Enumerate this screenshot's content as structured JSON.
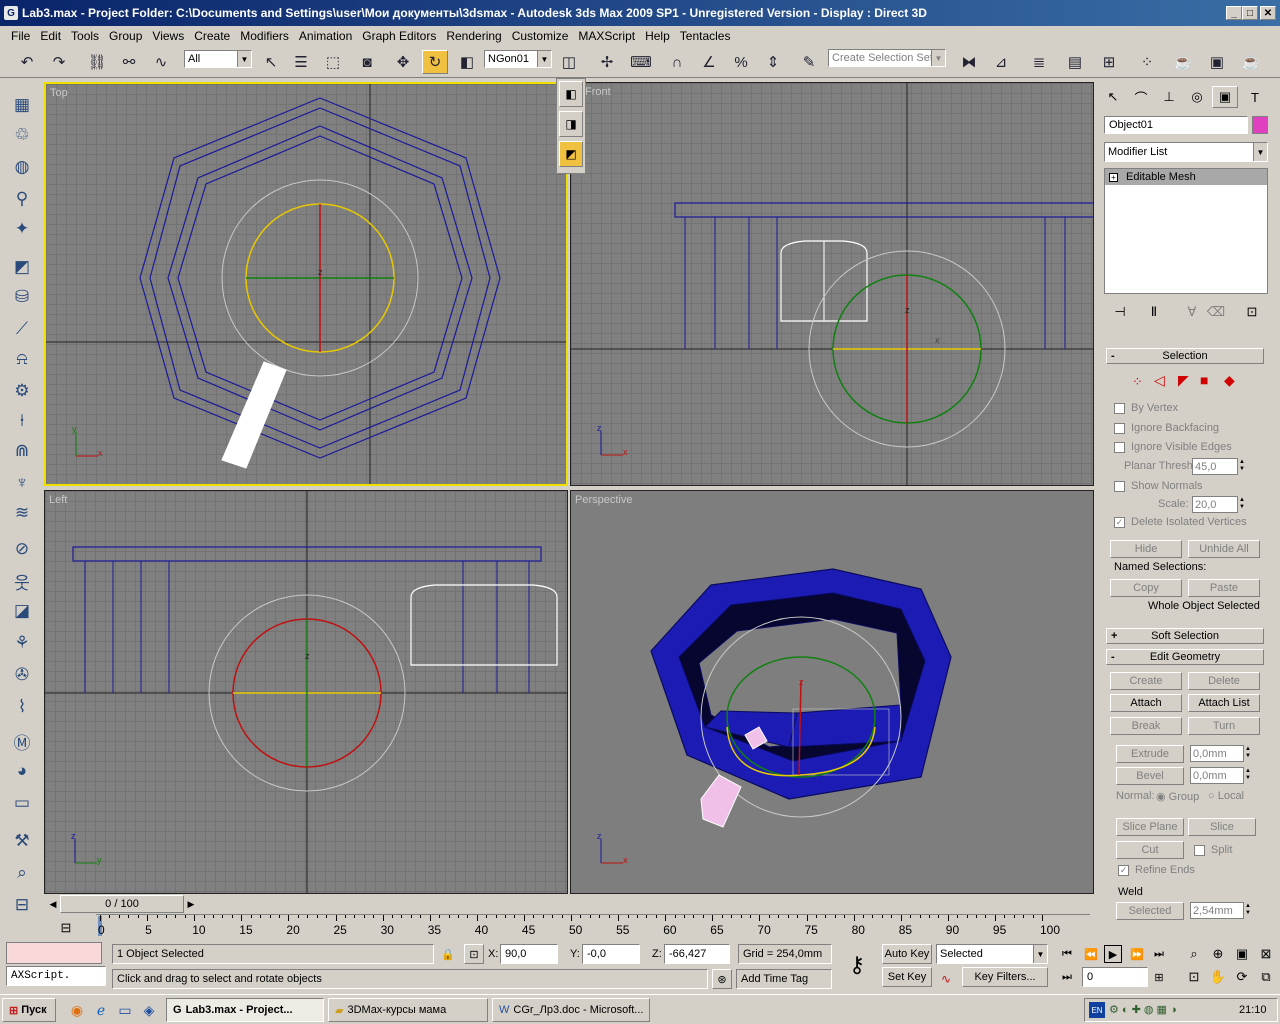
{
  "window": {
    "title": "Lab3.max      - Project Folder: C:\\Documents and Settings\\user\\Мои документы\\3dsmax      - Autodesk 3ds Max  2009 SP1   - Unregistered Version      - Display : Direct 3D",
    "min": "_",
    "max": "□",
    "close": "✕"
  },
  "menu": [
    "File",
    "Edit",
    "Tools",
    "Group",
    "Views",
    "Create",
    "Modifiers",
    "Animation",
    "Graph Editors",
    "Rendering",
    "Customize",
    "MAXScript",
    "Help",
    "Tentacles"
  ],
  "toolbar": {
    "filter": "All",
    "ref_coord": "NGon01",
    "selection_set_placeholder": "Create Selection Set"
  },
  "viewports": {
    "top": "Top",
    "front": "Front",
    "left": "Left",
    "perspective": "Perspective"
  },
  "axis": {
    "x": "x",
    "y": "y",
    "z": "z"
  },
  "cmdpanel": {
    "object_name": "Object01",
    "object_color": "#e040c0",
    "modifier_list": "Modifier List",
    "stack_item": "Editable Mesh",
    "selection": {
      "title": "Selection",
      "by_vertex": "By Vertex",
      "ignore_backfacing": "Ignore Backfacing",
      "ignore_visible_edges": "Ignore Visible Edges",
      "planar_thresh": "Planar Thresh:",
      "planar_value": "45,0",
      "show_normals": "Show Normals",
      "scale": "Scale:",
      "scale_value": "20,0",
      "delete_isolated": "Delete Isolated Vertices",
      "hide": "Hide",
      "unhide_all": "Unhide All",
      "named_selections": "Named Selections:",
      "copy": "Copy",
      "paste": "Paste",
      "whole_object": "Whole Object Selected"
    },
    "soft_selection": "Soft Selection",
    "edit_geometry": {
      "title": "Edit Geometry",
      "create": "Create",
      "delete": "Delete",
      "attach": "Attach",
      "attach_list": "Attach List",
      "break": "Break",
      "turn": "Turn",
      "extrude": "Extrude",
      "extrude_value": "0,0mm",
      "bevel": "Bevel",
      "bevel_value": "0,0mm",
      "normal": "Normal:",
      "group": "Group",
      "local": "Local",
      "slice_plane": "Slice Plane",
      "slice": "Slice",
      "cut": "Cut",
      "split": "Split",
      "refine_ends": "Refine Ends",
      "weld": "Weld",
      "selected": "Selected",
      "weld_value": "2,54mm"
    }
  },
  "timeline": {
    "frame": "0 / 100",
    "ticks": [
      "0",
      "5",
      "10",
      "15",
      "20",
      "25",
      "30",
      "35",
      "40",
      "45",
      "50",
      "55",
      "60",
      "65",
      "70",
      "75",
      "80",
      "85",
      "90",
      "95",
      "100"
    ]
  },
  "status": {
    "selected": "1 Object Selected",
    "prompt": "Click and drag to select and rotate objects",
    "script": "AXScript.",
    "x_label": "X:",
    "x": "90,0",
    "y_label": "Y:",
    "y": "-0,0",
    "z_label": "Z:",
    "z": "-66,427",
    "grid": "Grid = 254,0mm",
    "add_time_tag": "Add Time Tag",
    "auto_key": "Auto Key",
    "set_key": "Set Key",
    "key_mode": "Selected",
    "key_filters": "Key Filters...",
    "frame": "0"
  },
  "taskbar": {
    "start": "Пуск",
    "tasks": [
      "Lab3.max      - Project...",
      "3DMax-курсы мама",
      "CGr_Лр3.doc - Microsoft..."
    ],
    "lang": "EN",
    "clock": "21:10"
  }
}
